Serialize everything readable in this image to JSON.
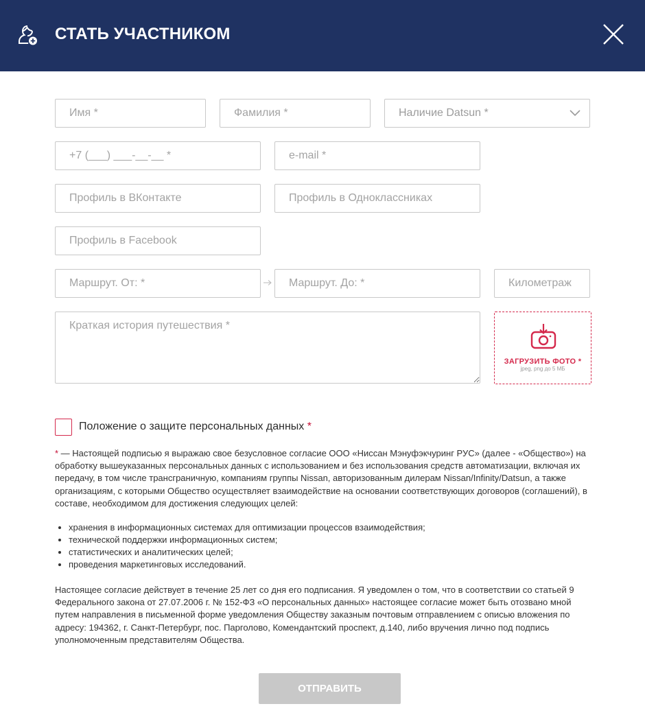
{
  "header": {
    "title": "СТАТЬ УЧАСТНИКОМ"
  },
  "form": {
    "first_name_placeholder": "Имя *",
    "last_name_placeholder": "Фамилия *",
    "datsun_select_value": "Наличие Datsun *",
    "phone_placeholder": "+7 (___) ___-__-__ *",
    "email_placeholder": "e-mail *",
    "vk_placeholder": "Профиль в ВКонтакте",
    "ok_placeholder": "Профиль в Одноклассниках",
    "fb_placeholder": "Профиль в Facebook",
    "route_from_placeholder": "Маршрут. От: *",
    "route_to_placeholder": "Маршрут. До: *",
    "mileage_placeholder": "Километраж",
    "story_placeholder": "Краткая история путешествия *"
  },
  "upload": {
    "label": "ЗАГРУЗИТЬ ФОТО *",
    "hint": "jpeg, png до 5 МБ"
  },
  "consent": {
    "label": "Положение о защите персональных данных",
    "required_mark": "*"
  },
  "legal": {
    "star": "*",
    "intro": " — Настоящей подписью я выражаю свое безусловное согласие ООО «Ниссан Мэнуфэкчуринг РУС» (далее - «Общество») на обработку вышеуказанных персональных данных с использованием и без использования средств автоматизации, включая их передачу, в том числе трансграничную, компаниям группы Nissan, авторизованным дилерам Nissan/Infinity/Datsun, а также организациям, с которыми Общество осуществляет взаимодействие на основании соответствующих договоров (соглашений), в составе, необходимом для достижения следующих целей:",
    "purposes": [
      "хранения в информационных системах для оптимизации процессов взаимодействия;",
      "технической поддержки информационных систем;",
      "статистических и аналитических целей;",
      "проведения маркетинговых исследований."
    ],
    "outro": "Настоящее согласие действует в течение 25 лет со дня его подписания. Я уведомлен о том, что в соответствии со статьей 9 Федерального закона от 27.07.2006 г. № 152-ФЗ «О персональных данных» настоящее согласие может быть отозвано мной путем направления в письменной форме уведомления Обществу заказным почтовым отправлением с описью вложения по адресу: 194362, г. Санкт-Петербург, пос. Парголово, Комендантский проспект, д.140, либо вручения лично под подпись уполномоченным представителям Общества."
  },
  "submit_label": "ОТПРАВИТЬ",
  "colors": {
    "header_bg": "#1f3262",
    "accent": "#d4284b",
    "submit_disabled": "#c8c8c8"
  }
}
